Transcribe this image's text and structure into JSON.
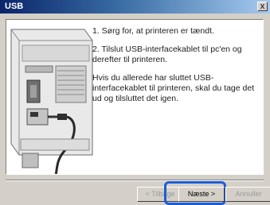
{
  "window": {
    "title": "USB",
    "close_symbol": "x"
  },
  "instructions": {
    "step1": "1. Sørg for, at printeren er tændt.",
    "step2": "2. Tilslut USB-interfacekablet til pc'en og derefter til printeren.",
    "note": "Hvis du allerede har sluttet USB-interfacekablet til printeren, skal du tage det ud og tilsluttet det igen."
  },
  "buttons": {
    "back": "< Tilbage",
    "next": "Næste >",
    "cancel": "Annuller"
  },
  "colors": {
    "title_bar": "#0a246a",
    "focus_highlight": "#1a5ed8",
    "dialog_bg": "#d4d0c8"
  }
}
